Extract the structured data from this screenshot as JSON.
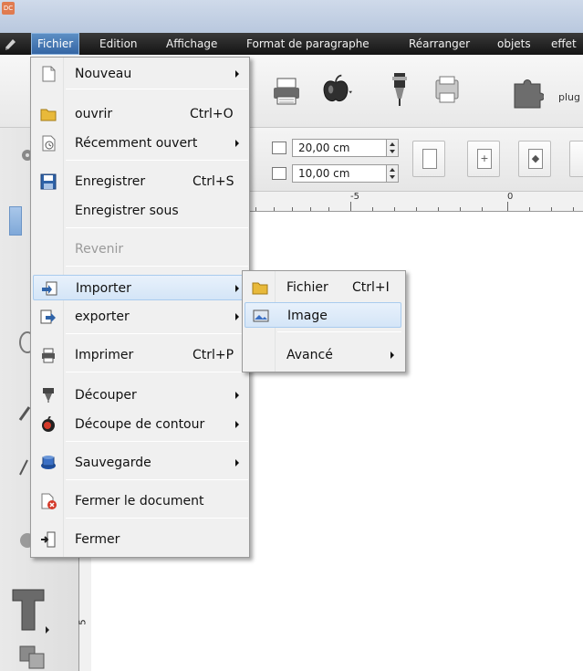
{
  "menubar": {
    "items": [
      "Fichier",
      "Edition",
      "Affichage",
      "Format de paragraphe",
      "Réarranger",
      "objets",
      "effet"
    ]
  },
  "app_icon_text": "DC",
  "toolbar": {
    "plugin_label": "plug"
  },
  "dimensions": {
    "width": "20,00 cm",
    "height": "10,00 cm"
  },
  "ruler": {
    "labels": [
      "-5",
      "0"
    ]
  },
  "vruler": {
    "label": "5"
  },
  "file_menu": {
    "items": [
      {
        "label": "Nouveau",
        "shortcut": "",
        "submenu": true,
        "icon": "new-doc-icon"
      },
      {
        "label": "ouvrir",
        "shortcut": "Ctrl+O",
        "submenu": false,
        "icon": "folder-icon"
      },
      {
        "label": "Récemment ouvert",
        "shortcut": "",
        "submenu": true,
        "icon": "recent-icon"
      },
      {
        "label": "Enregistrer",
        "shortcut": "Ctrl+S",
        "submenu": false,
        "icon": "floppy-icon"
      },
      {
        "label": "Enregistrer sous",
        "shortcut": "",
        "submenu": false,
        "icon": ""
      },
      {
        "label": "Revenir",
        "shortcut": "",
        "submenu": false,
        "icon": "",
        "disabled": true
      },
      {
        "label": "Importer",
        "shortcut": "",
        "submenu": true,
        "icon": "import-icon",
        "highlighted": true
      },
      {
        "label": "exporter",
        "shortcut": "",
        "submenu": true,
        "icon": "export-icon"
      },
      {
        "label": "Imprimer",
        "shortcut": "Ctrl+P",
        "submenu": false,
        "icon": "printer-icon"
      },
      {
        "label": "Découper",
        "shortcut": "",
        "submenu": true,
        "icon": "cutter-icon"
      },
      {
        "label": "Découpe de contour",
        "shortcut": "",
        "submenu": true,
        "icon": "contour-cut-icon"
      },
      {
        "label": "Sauvegarde",
        "shortcut": "",
        "submenu": true,
        "icon": "backup-icon"
      },
      {
        "label": "Fermer le document",
        "shortcut": "",
        "submenu": false,
        "icon": "close-doc-icon"
      },
      {
        "label": "Fermer",
        "shortcut": "",
        "submenu": false,
        "icon": "exit-icon"
      }
    ]
  },
  "import_submenu": {
    "items": [
      {
        "label": "Fichier",
        "shortcut": "Ctrl+I",
        "submenu": false,
        "icon": "folder-icon"
      },
      {
        "label": "Image",
        "shortcut": "",
        "submenu": false,
        "icon": "image-icon",
        "highlighted": true
      },
      {
        "label": "Avancé",
        "shortcut": "",
        "submenu": true,
        "icon": ""
      }
    ]
  },
  "colors": {
    "menubar_bg": "#1e1e1e",
    "menu_bg": "#f0f0f0",
    "highlight": "#d4e5f7",
    "active_menu": "#3465a4"
  }
}
